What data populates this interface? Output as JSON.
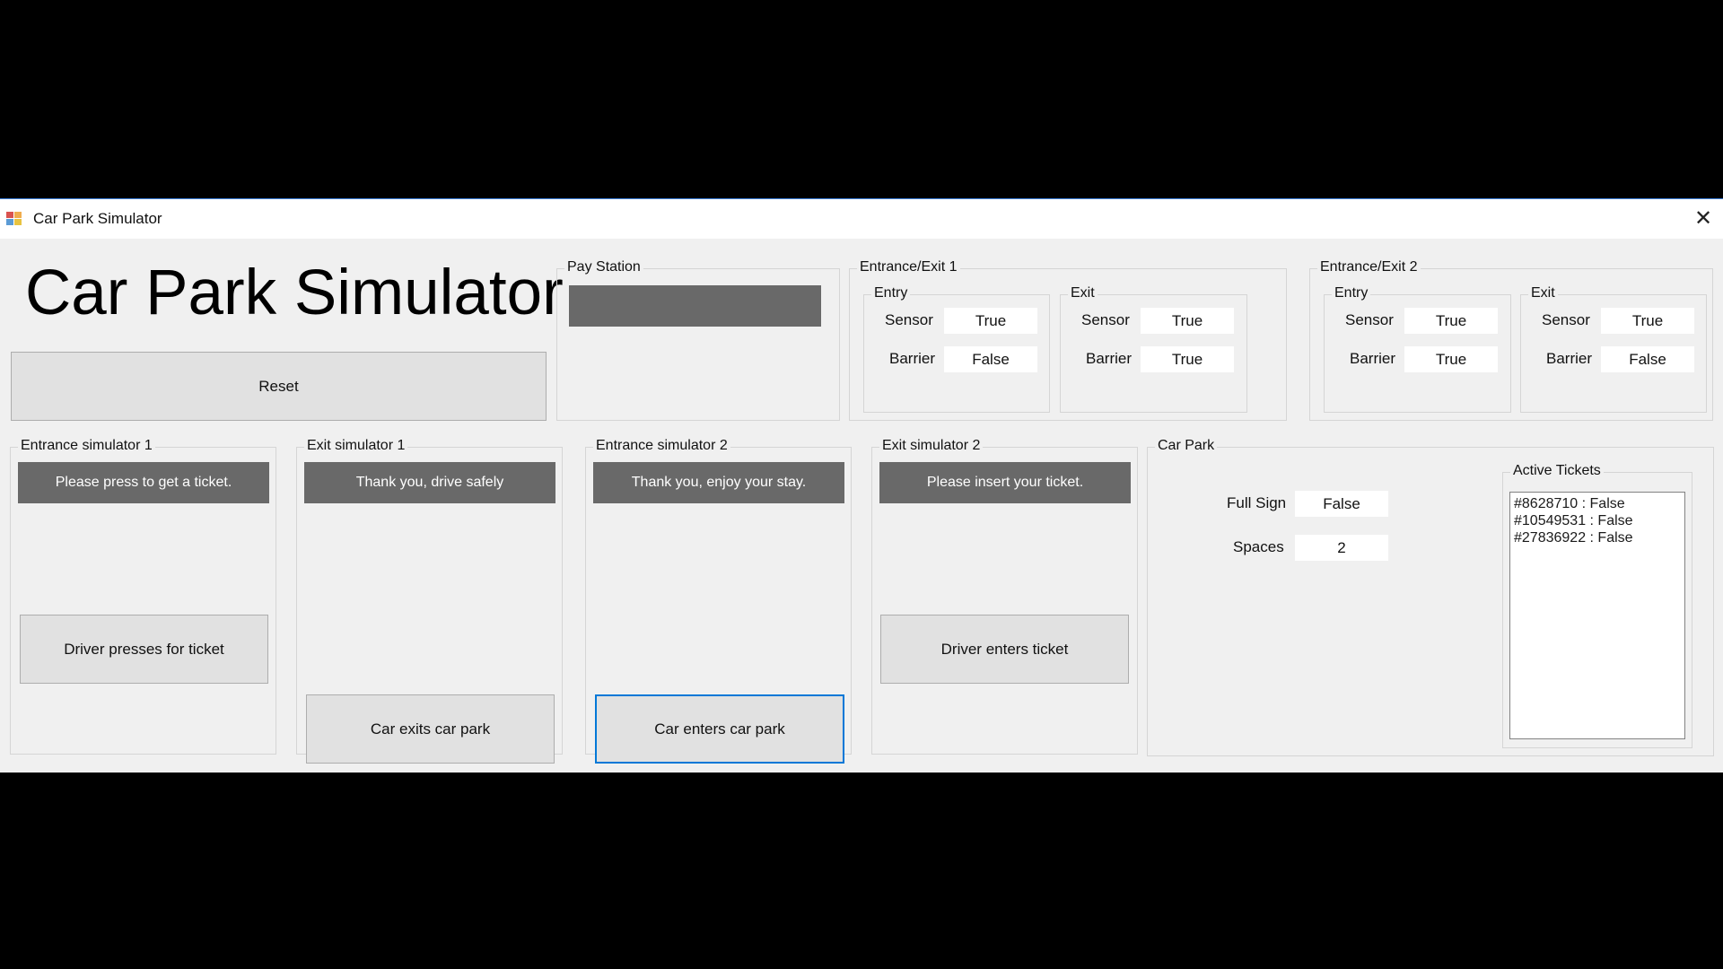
{
  "window": {
    "title": "Car Park Simulator"
  },
  "heading": "Car Park Simulator",
  "reset_label": "Reset",
  "pay_station": {
    "label": "Pay Station",
    "display": ""
  },
  "ee1": {
    "label": "Entrance/Exit 1",
    "entry": {
      "label": "Entry",
      "sensor_label": "Sensor",
      "sensor": "True",
      "barrier_label": "Barrier",
      "barrier": "False"
    },
    "exit": {
      "label": "Exit",
      "sensor_label": "Sensor",
      "sensor": "True",
      "barrier_label": "Barrier",
      "barrier": "True"
    }
  },
  "ee2": {
    "label": "Entrance/Exit 2",
    "entry": {
      "label": "Entry",
      "sensor_label": "Sensor",
      "sensor": "True",
      "barrier_label": "Barrier",
      "barrier": "True"
    },
    "exit": {
      "label": "Exit",
      "sensor_label": "Sensor",
      "sensor": "True",
      "barrier_label": "Barrier",
      "barrier": "False"
    }
  },
  "es1": {
    "label": "Entrance simulator 1",
    "message": "Please press to get a ticket.",
    "button": "Driver presses for ticket"
  },
  "xs1": {
    "label": "Exit simulator 1",
    "message": "Thank you, drive safely",
    "button": "Car exits car park"
  },
  "es2": {
    "label": "Entrance simulator 2",
    "message": "Thank you, enjoy your stay.",
    "button": "Car enters car park"
  },
  "xs2": {
    "label": "Exit simulator 2",
    "message": "Please insert your ticket.",
    "button": "Driver enters ticket"
  },
  "car_park": {
    "label": "Car Park",
    "full_sign_label": "Full Sign",
    "full_sign": "False",
    "spaces_label": "Spaces",
    "spaces": "2",
    "active_tickets_label": "Active Tickets",
    "tickets": [
      "#8628710 : False",
      "#10549531 : False",
      "#27836922 : False"
    ]
  },
  "icons": {
    "app": "app-icon",
    "close": "close-icon"
  }
}
